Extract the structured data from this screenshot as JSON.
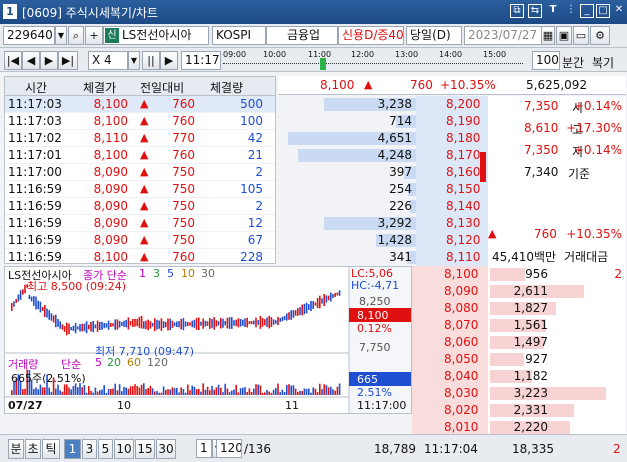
{
  "title": {
    "num": "1",
    "text": "[0609] 주식시세복기/차트"
  },
  "toolbar": {
    "code": "229640",
    "stock_badge": "신",
    "stock_name": "LS전선아시아",
    "market": "KOSPI",
    "sector": "금융업",
    "credit": "신용D/증40",
    "day_mode": "당일(D)",
    "date": "2023/07/27",
    "interval": "100",
    "interval_unit": "분간",
    "replay": "복기"
  },
  "player": {
    "speed": "X 4",
    "time": "11:17",
    "ticks": [
      "09:00",
      "10:00",
      "11:00",
      "12:00",
      "13:00",
      "14:00",
      "15:00"
    ]
  },
  "table": {
    "headers": [
      "시간",
      "체결가",
      "전일대비",
      "체결량"
    ],
    "rows": [
      {
        "time": "11:17:03",
        "price": "8,100",
        "chg": "760",
        "vol": "500"
      },
      {
        "time": "11:17:03",
        "price": "8,100",
        "chg": "760",
        "vol": "100"
      },
      {
        "time": "11:17:02",
        "price": "8,110",
        "chg": "770",
        "vol": "42"
      },
      {
        "time": "11:17:01",
        "price": "8,100",
        "chg": "760",
        "vol": "21"
      },
      {
        "time": "11:17:00",
        "price": "8,090",
        "chg": "750",
        "vol": "2"
      },
      {
        "time": "11:16:59",
        "price": "8,090",
        "chg": "750",
        "vol": "105"
      },
      {
        "time": "11:16:59",
        "price": "8,090",
        "chg": "750",
        "vol": "2"
      },
      {
        "time": "11:16:59",
        "price": "8,090",
        "chg": "750",
        "vol": "12"
      },
      {
        "time": "11:16:59",
        "price": "8,090",
        "chg": "750",
        "vol": "67"
      },
      {
        "time": "11:16:59",
        "price": "8,100",
        "chg": "760",
        "vol": "228"
      }
    ]
  },
  "quote": {
    "price": "8,100",
    "chg": "760",
    "pct": "+10.35%",
    "volume": "5,625,092"
  },
  "asks": [
    {
      "qty": "3,238",
      "price": "8,200",
      "bar": 0.72
    },
    {
      "qty": "714",
      "price": "8,190",
      "bar": 0.16
    },
    {
      "qty": "4,651",
      "price": "8,180",
      "bar": 1.0
    },
    {
      "qty": "4,248",
      "price": "8,170",
      "bar": 0.92
    },
    {
      "qty": "397",
      "price": "8,160",
      "bar": 0.09
    },
    {
      "qty": "254",
      "price": "8,150",
      "bar": 0.06
    },
    {
      "qty": "226",
      "price": "8,140",
      "bar": 0.05
    },
    {
      "qty": "3,292",
      "price": "8,130",
      "bar": 0.72
    },
    {
      "qty": "1,428",
      "price": "8,120",
      "bar": 0.31
    },
    {
      "qty": "341",
      "price": "8,110",
      "bar": 0.07
    }
  ],
  "info": [
    {
      "val": "7,350",
      "label": "시",
      "pct": "+0.14%"
    },
    {
      "val": "8,610",
      "label": "고",
      "pct": "+17.30%"
    },
    {
      "val": "7,350",
      "label": "저",
      "pct": "+0.14%"
    },
    {
      "val": "7,340",
      "label": "기준",
      "pct": ""
    }
  ],
  "upper": {
    "chg": "760",
    "pct": "+10.35%",
    "amount": "45,410백만",
    "amount_label": "거래대금"
  },
  "bids": [
    {
      "price": "8,100",
      "qty": "956",
      "extra": "2",
      "bar": 0.29
    },
    {
      "price": "8,090",
      "qty": "2,611",
      "extra": "",
      "bar": 0.78
    },
    {
      "price": "8,080",
      "qty": "1,827",
      "extra": "",
      "bar": 0.55
    },
    {
      "price": "8,070",
      "qty": "1,561",
      "extra": "",
      "bar": 0.47
    },
    {
      "price": "8,060",
      "qty": "1,497",
      "extra": "",
      "bar": 0.45
    },
    {
      "price": "8,050",
      "qty": "927",
      "extra": "",
      "bar": 0.28
    },
    {
      "price": "8,040",
      "qty": "1,182",
      "extra": "",
      "bar": 0.35
    },
    {
      "price": "8,030",
      "qty": "3,223",
      "extra": "",
      "bar": 0.97
    },
    {
      "price": "8,020",
      "qty": "2,331",
      "extra": "",
      "bar": 0.7
    },
    {
      "price": "8,010",
      "qty": "2,220",
      "extra": "",
      "bar": 0.67
    }
  ],
  "chart": {
    "name": "LS전선아시아",
    "ma_label": "종가 단순",
    "ma": [
      "1",
      "3",
      "5",
      "10",
      "30"
    ],
    "lc": "LC:5,06",
    "hc": "HC:-4,71",
    "y1": "8,250",
    "cur": "8,100",
    "curpct": "0.12%",
    "y2": "7,750",
    "high": "최고 8,500 (09:24)",
    "low": "최저 7,710 (09:47)",
    "vol_label": "거래량",
    "vol_ma": "단순",
    "vol_ma_vals": [
      "5",
      "20",
      "60",
      "120"
    ],
    "vol_val": "665주(2.51%)",
    "vol_box": "665",
    "vol_pct": "2.51%",
    "date": "07/27",
    "x10": "10",
    "x11": "11",
    "time": "11:17:00"
  },
  "bottom": {
    "tabs": [
      "분",
      "초",
      "틱"
    ],
    "nums": [
      "1",
      "3",
      "5",
      "10",
      "15",
      "30"
    ],
    "mult": "1",
    "page": "120",
    "total": "/136",
    "ask_total": "18,789",
    "time": "11:17:04",
    "bid_total": "18,335",
    "extra": "2"
  }
}
